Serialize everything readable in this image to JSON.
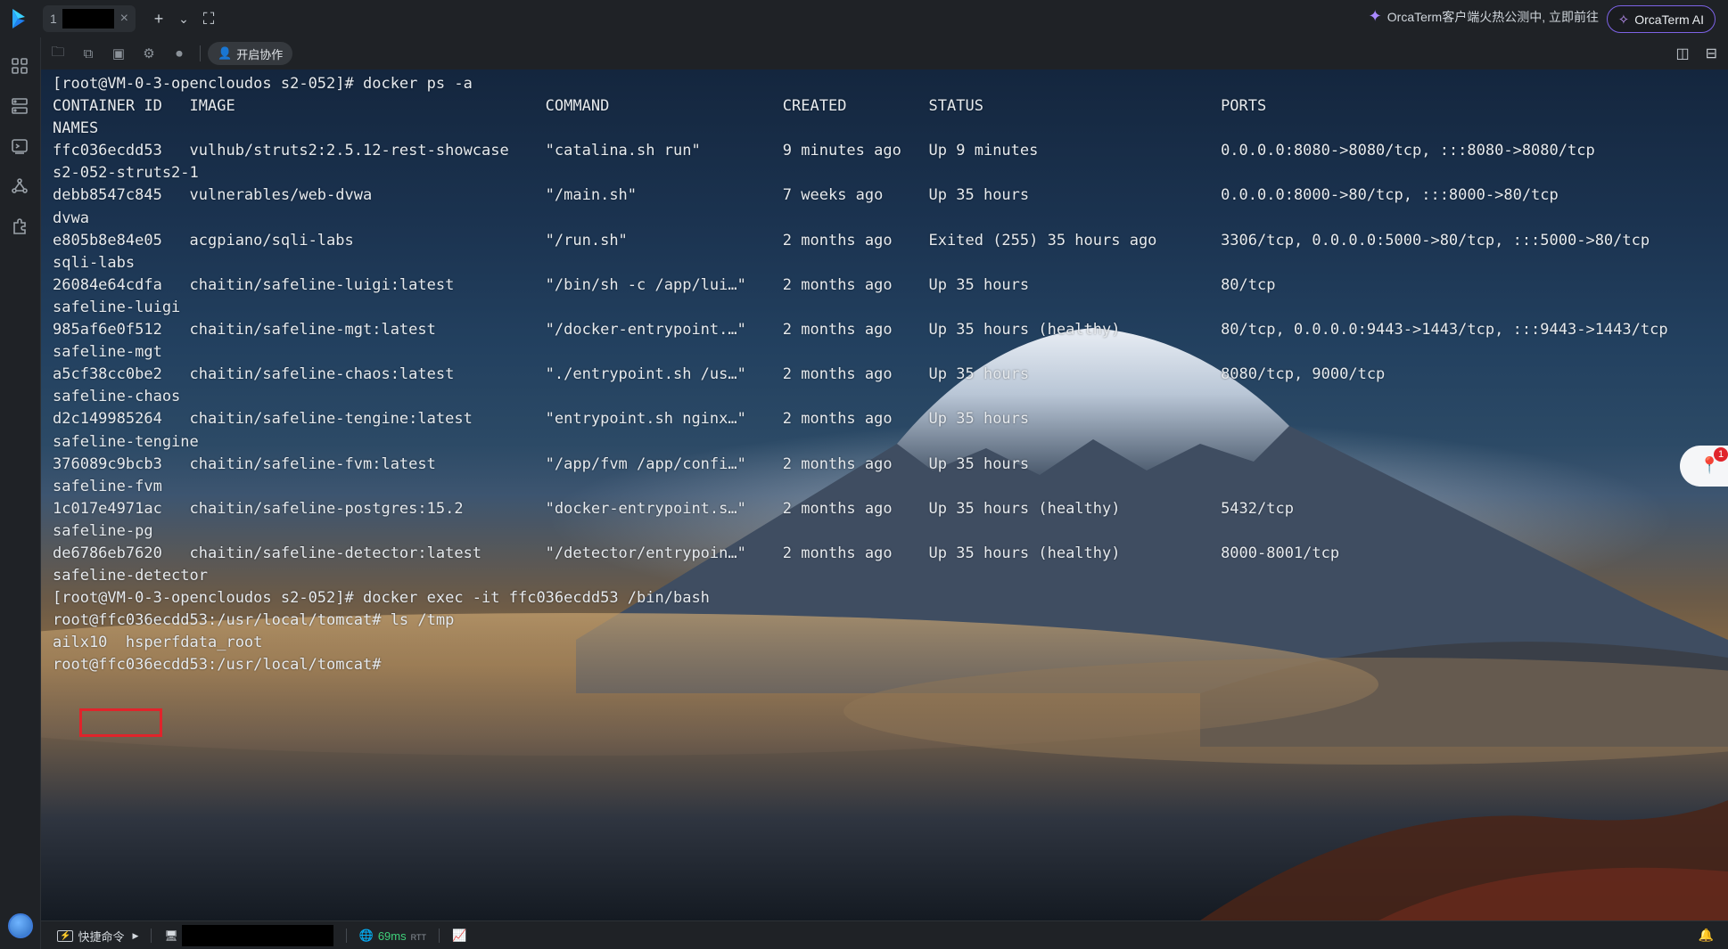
{
  "tabs": [
    {
      "number": "1",
      "close": "×"
    }
  ],
  "tab_actions": {
    "new_tab": "+",
    "dropdown": "⌄",
    "fullscreen": "⛶"
  },
  "promo": {
    "text": "OrcaTerm客户端火热公测中, 立即前往"
  },
  "ai_button": {
    "label": "OrcaTerm AI"
  },
  "toolbar": {
    "collab_label": "开启协作",
    "icons": [
      "sftp-icon",
      "session-icon",
      "monitor-icon",
      "settings-icon",
      "record-icon"
    ]
  },
  "sidebar": {
    "icons": [
      "apps-grid-icon",
      "server-list-icon",
      "terminal-icon",
      "network-icon",
      "plugin-icon"
    ]
  },
  "terminal": {
    "lines": [
      "[root@VM-0-3-opencloudos s2-052]# docker ps -a",
      "CONTAINER ID   IMAGE                                  COMMAND                   CREATED         STATUS                          PORTS",
      "NAMES",
      "ffc036ecdd53   vulhub/struts2:2.5.12-rest-showcase    \"catalina.sh run\"         9 minutes ago   Up 9 minutes                    0.0.0.0:8080->8080/tcp, :::8080->8080/tcp",
      "s2-052-struts2-1",
      "debb8547c845   vulnerables/web-dvwa                   \"/main.sh\"                7 weeks ago     Up 35 hours                     0.0.0.0:8000->80/tcp, :::8000->80/tcp",
      "dvwa",
      "e805b8e84e05   acgpiano/sqli-labs                     \"/run.sh\"                 2 months ago    Exited (255) 35 hours ago       3306/tcp, 0.0.0.0:5000->80/tcp, :::5000->80/tcp",
      "sqli-labs",
      "26084e64cdfa   chaitin/safeline-luigi:latest          \"/bin/sh -c /app/lui…\"    2 months ago    Up 35 hours                     80/tcp",
      "safeline-luigi",
      "985af6e0f512   chaitin/safeline-mgt:latest            \"/docker-entrypoint.…\"    2 months ago    Up 35 hours (healthy)           80/tcp, 0.0.0.0:9443->1443/tcp, :::9443->1443/tcp",
      "safeline-mgt",
      "a5cf38cc0be2   chaitin/safeline-chaos:latest          \"./entrypoint.sh /us…\"    2 months ago    Up 35 hours                     8080/tcp, 9000/tcp",
      "safeline-chaos",
      "d2c149985264   chaitin/safeline-tengine:latest        \"entrypoint.sh nginx…\"    2 months ago    Up 35 hours",
      "safeline-tengine",
      "376089c9bcb3   chaitin/safeline-fvm:latest            \"/app/fvm /app/confi…\"    2 months ago    Up 35 hours",
      "safeline-fvm",
      "1c017e4971ac   chaitin/safeline-postgres:15.2         \"docker-entrypoint.s…\"    2 months ago    Up 35 hours (healthy)           5432/tcp",
      "safeline-pg",
      "de6786eb7620   chaitin/safeline-detector:latest       \"/detector/entrypoin…\"    2 months ago    Up 35 hours (healthy)           8000-8001/tcp",
      "safeline-detector",
      "[root@VM-0-3-opencloudos s2-052]# docker exec -it ffc036ecdd53 /bin/bash",
      "root@ffc036ecdd53:/usr/local/tomcat# ls /tmp",
      "ailx10  hsperfdata_root",
      "root@ffc036ecdd53:/usr/local/tomcat#"
    ],
    "highlighted_text": "ailx10"
  },
  "floating_badge": {
    "count": "1"
  },
  "statusbar": {
    "quick_cmd_label": "快捷命令",
    "latency_value": "69ms",
    "latency_unit": "RTT"
  }
}
